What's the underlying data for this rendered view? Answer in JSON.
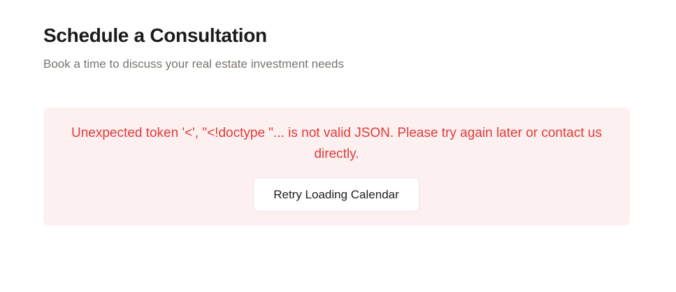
{
  "header": {
    "title": "Schedule a Consultation",
    "subtitle": "Book a time to discuss your real estate investment needs"
  },
  "error": {
    "message": "Unexpected token '<', \"<!doctype \"... is not valid JSON. Please try again later or contact us directly.",
    "retry_label": "Retry Loading Calendar"
  },
  "colors": {
    "error_text": "#e23a3a",
    "error_background": "#fdf0f0",
    "title_text": "#1b1b1b",
    "subtitle_text": "#7a736d"
  }
}
